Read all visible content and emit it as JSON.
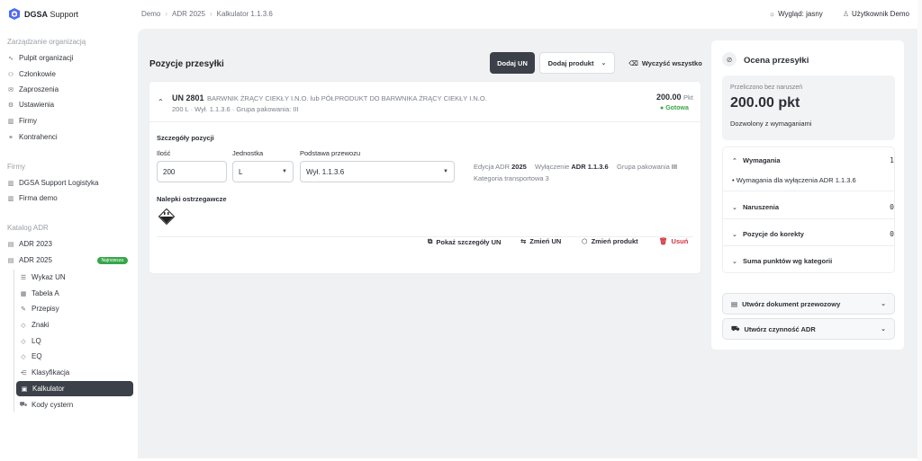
{
  "brand": {
    "name_bold": "DGSA",
    "name_rest": " Support"
  },
  "sidebar": {
    "org_section": "Zarządzanie organizacją",
    "org_items": [
      {
        "label": "Pulpit organizacji",
        "icon": "pulse-icon"
      },
      {
        "label": "Członkowie",
        "icon": "users-icon"
      },
      {
        "label": "Zaproszenia",
        "icon": "mail-icon"
      },
      {
        "label": "Ustawienia",
        "icon": "gear-icon"
      },
      {
        "label": "Firmy",
        "icon": "building-icon"
      },
      {
        "label": "Kontrahenci",
        "icon": "handshake-icon"
      }
    ],
    "firms_section": "Firmy",
    "firm_items": [
      {
        "label": "DGSA Support Logistyka",
        "icon": "building-icon"
      },
      {
        "label": "Firma demo",
        "icon": "building-icon"
      }
    ],
    "catalog_section": "Katalog ADR",
    "adr_2023": "ADR 2023",
    "adr_2025": "ADR 2025",
    "adr_2025_badge": "Najnowsza",
    "adr_sub_items": [
      {
        "label": "Wykaz UN",
        "icon": "list-icon"
      },
      {
        "label": "Tabela A",
        "icon": "table-icon"
      },
      {
        "label": "Przepisy",
        "icon": "book-icon"
      },
      {
        "label": "Znaki",
        "icon": "diamond-icon"
      },
      {
        "label": "LQ",
        "icon": "diamond-icon"
      },
      {
        "label": "EQ",
        "icon": "diamond-icon"
      },
      {
        "label": "Klasyfikacja",
        "icon": "share-icon"
      },
      {
        "label": "Kalkulator",
        "icon": "calculator-icon"
      },
      {
        "label": "Kody cystern",
        "icon": "truck-icon"
      }
    ],
    "active_item": "Kalkulator"
  },
  "breadcrumb": [
    "Demo",
    "ADR 2025",
    "Kalkulator 1.1.3.6"
  ],
  "topbar": {
    "appearance": "Wygląd: jasny",
    "user": "Użytkownik Demo"
  },
  "main": {
    "title": "Pozycje przesyłki",
    "add_un": "Dodaj UN",
    "add_product": "Dodaj produkt",
    "clear_all": "Wyczyść wszystko"
  },
  "item": {
    "un": "UN 2801",
    "name": "BARWNIK ŻRĄCY CIEKŁY I.N.O. lub PÓŁPRODUKT DO BARWNIKA ŻRĄCY CIEKŁY I.N.O.",
    "meta": "200 L · Wył. 1.1.3.6 · Grupa pakowania: III",
    "points": "200.00",
    "points_unit": "Pkt",
    "status": "Gotowa",
    "details_title": "Szczegóły pozycji",
    "qty_label": "Ilość",
    "qty_value": "200",
    "unit_label": "Jednostka",
    "unit_value": "L",
    "basis_label": "Podstawa przewozu",
    "basis_value": "Wył. 1.1.3.6",
    "edition_label": "Edycja ADR",
    "edition_value": "2025",
    "exemption_label": "Wyłączenie",
    "exemption_value": "ADR 1.1.3.6",
    "group_label": "Grupa pakowania",
    "group_value": "III",
    "category_label": "Kategoria transportowa",
    "category_value": "3",
    "labels_title": "Nalepki ostrzegawcze",
    "actions": {
      "details": "Pokaż szczegóły UN",
      "change_un": "Zmień UN",
      "change_product": "Zmień produkt",
      "delete": "Usuń"
    }
  },
  "assessment": {
    "title": "Ocena przesyłki",
    "calc_note": "Przeliczono bez naruszeń",
    "score": "200.00 pkt",
    "allowed": "Dozwolony z wymaganiami",
    "requirements": "Wymagania",
    "requirements_count": "1",
    "requirement_item": "Wymagania dla wyłączenia ADR 1.1.3.6",
    "violations": "Naruszenia",
    "violations_count": "0",
    "corrections": "Pozycje do korekty",
    "corrections_count": "0",
    "sum_by_category": "Suma punktów wg kategorii",
    "create_doc": "Utwórz dokument przewozowy",
    "create_activity": "Utwórz czynność ADR"
  },
  "colors": {
    "accent_dark": "#3b4049",
    "status_green": "#37a64a",
    "danger": "#d0343a"
  }
}
